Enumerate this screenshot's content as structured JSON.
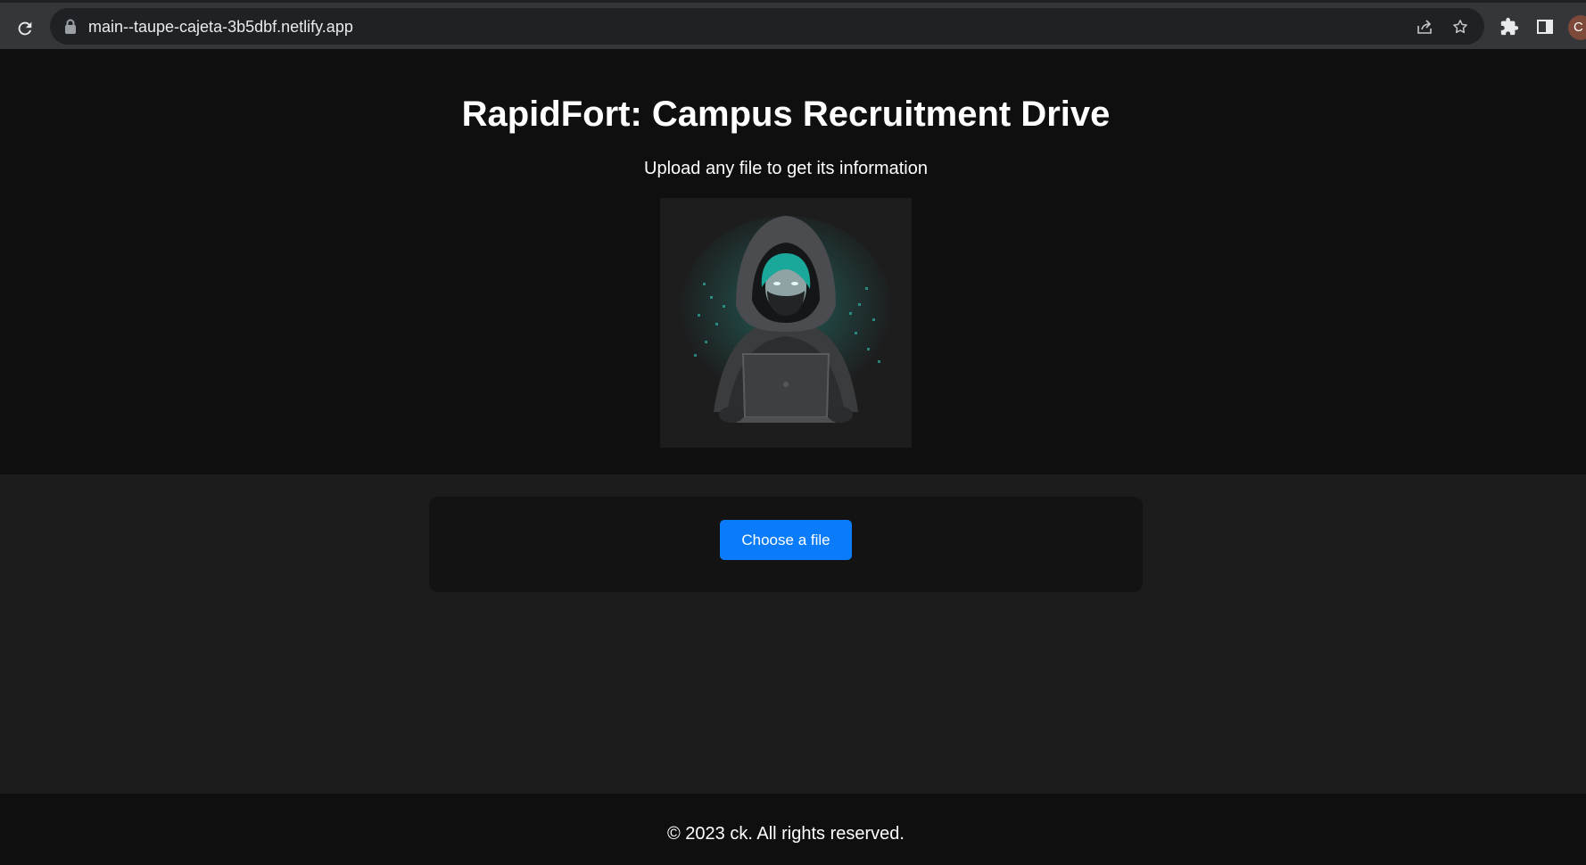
{
  "browser": {
    "url": "main--taupe-cajeta-3b5dbf.netlify.app",
    "profile_initial": "C",
    "icons": {
      "reload": "reload-icon",
      "lock": "lock-icon",
      "share": "share-icon",
      "bookmark": "star-icon",
      "extensions": "puzzle-icon",
      "side_panel": "side-panel-icon"
    }
  },
  "hero": {
    "title": "RapidFort: Campus Recruitment Drive",
    "subtitle": "Upload any file to get its information",
    "image": "hooded-hacker-with-laptop"
  },
  "upload": {
    "button_label": "Choose a file"
  },
  "footer": {
    "copyright": "© 2023 ck. All rights reserved."
  },
  "colors": {
    "page_bg": "#1c1c1d",
    "hero_bg": "#0f0f0f",
    "card_bg": "#131314",
    "button_bg": "#0a7cf9",
    "accent_teal": "#2fd6c3"
  }
}
